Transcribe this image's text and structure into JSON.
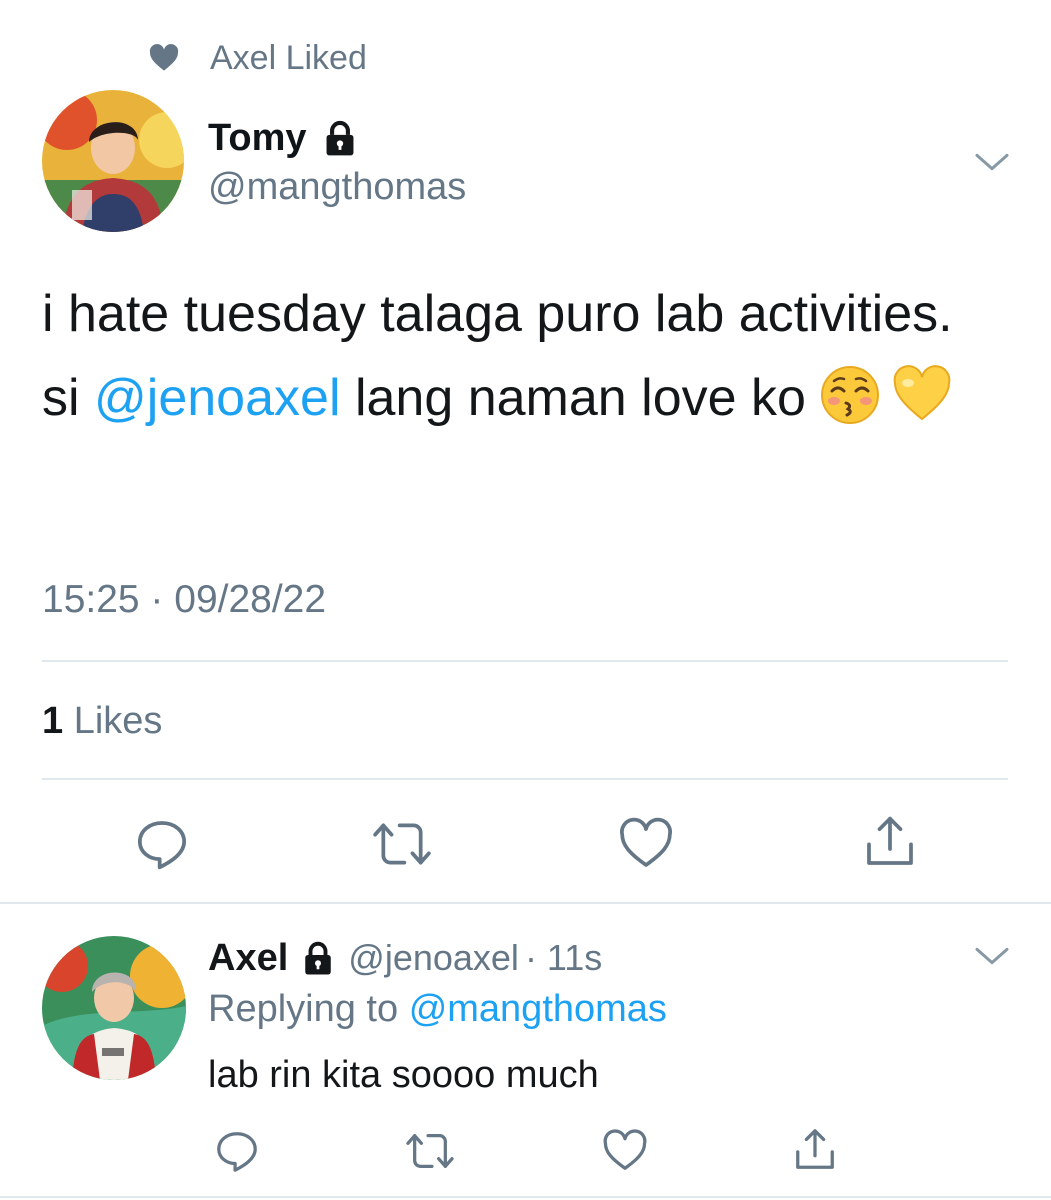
{
  "context": {
    "label": "Axel Liked",
    "icon": "heart-icon"
  },
  "tweet": {
    "author_name": "Tomy",
    "author_handle": "@mangthomas",
    "text_part1": "i hate tuesday talaga puro lab activities. si ",
    "mention": "@jenoaxel",
    "text_part2": " lang naman love ko ",
    "emojis": [
      "kissing-face-closed-eyes",
      "yellow-heart"
    ],
    "timestamp": "15:25 · 09/28/22",
    "likes_count": "1",
    "likes_label": "Likes",
    "actions": [
      "reply-icon",
      "retweet-icon",
      "like-icon",
      "share-icon"
    ]
  },
  "reply": {
    "author_name": "Axel",
    "author_handle": "@jenoaxel",
    "time": "· 11s",
    "replying_prefix": "Replying to",
    "replying_to": "@mangthomas",
    "text": "lab rin kita soooo much"
  },
  "colors": {
    "accent": "#1da1f2",
    "secondary_text": "#657786",
    "divider": "#e1e8ed"
  }
}
